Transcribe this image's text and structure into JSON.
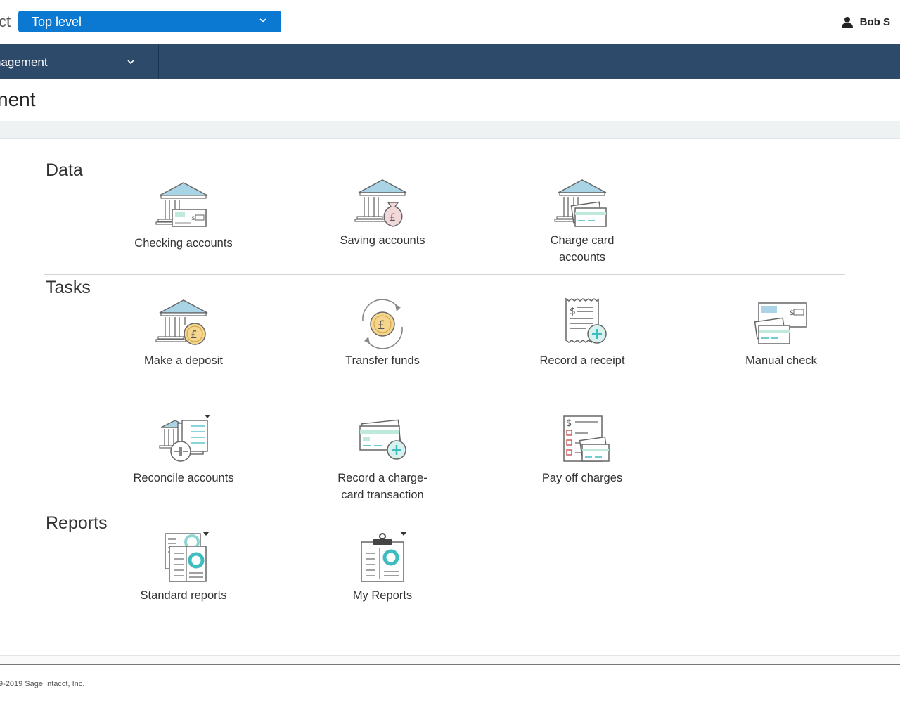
{
  "header": {
    "brand_fragment": "ct",
    "entity_select": {
      "value": "Top level"
    },
    "user": {
      "name": "Bob S"
    }
  },
  "nav": {
    "active_item": "nagement"
  },
  "page": {
    "title": "nent"
  },
  "sections": [
    {
      "title": "Data",
      "tiles": [
        {
          "label": "Checking accounts",
          "icon": "bank-check-icon"
        },
        {
          "label": "Saving accounts",
          "icon": "bank-moneybag-icon"
        },
        {
          "label": "Charge card accounts",
          "icon": "bank-cards-icon"
        }
      ]
    },
    {
      "title": "Tasks",
      "tiles": [
        {
          "label": "Make a deposit",
          "icon": "bank-coin-icon"
        },
        {
          "label": "Transfer funds",
          "icon": "transfer-coin-icon"
        },
        {
          "label": "Record a receipt",
          "icon": "receipt-add-icon"
        },
        {
          "label": "Manual check",
          "icon": "check-cards-icon"
        },
        {
          "label": "Reconcile accounts",
          "icon": "reconcile-icon"
        },
        {
          "label": "Record a charge-card transaction",
          "icon": "card-add-icon"
        },
        {
          "label": "Pay off charges",
          "icon": "checklist-cards-icon"
        }
      ]
    },
    {
      "title": "Reports",
      "tiles": [
        {
          "label": "Standard reports",
          "icon": "standard-reports-icon"
        },
        {
          "label": "My Reports",
          "icon": "clipboard-report-icon"
        }
      ]
    }
  ],
  "footer": {
    "copyright": "9-2019 Sage Intacct, Inc."
  },
  "colors": {
    "primary": "#0b78d1",
    "nav_bg": "#2e4a6b",
    "icon_blue": "#a8d4e6",
    "icon_teal": "#3fbcc0",
    "icon_gold": "#f6d58c"
  }
}
